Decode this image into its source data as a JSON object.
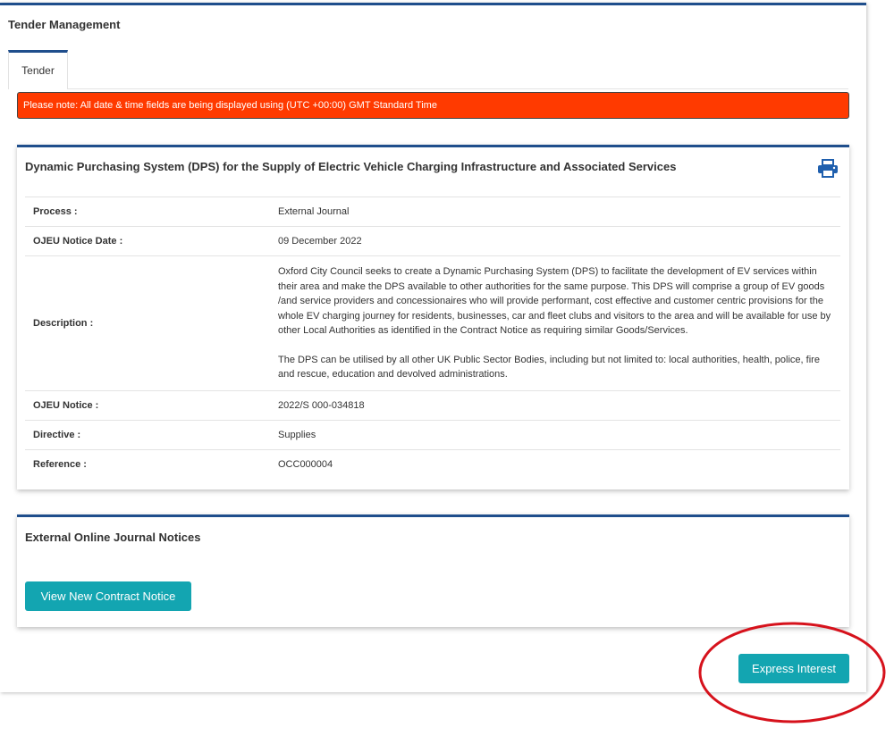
{
  "header": {
    "title": "Tender Management"
  },
  "tabs": [
    {
      "label": "Tender",
      "active": true
    }
  ],
  "notice": {
    "text": "Please note: All date & time fields are being displayed using (UTC +00:00) GMT Standard Time",
    "color": "#ff3a00"
  },
  "tender": {
    "title": "Dynamic Purchasing System (DPS) for the Supply of Electric Vehicle Charging Infrastructure and Associated Services",
    "print_icon": "printer-icon",
    "fields": {
      "process": {
        "label": "Process :",
        "value": "External Journal"
      },
      "ojeu_notice_date": {
        "label": "OJEU Notice Date :",
        "value": "09 December 2022"
      },
      "description": {
        "label": "Description :",
        "paragraphs": [
          "Oxford City Council seeks to create a Dynamic Purchasing System (DPS) to facilitate the development of EV services within their area and make the DPS available to other authorities for the same purpose. This DPS will comprise a group of EV goods /and service providers and concessionaires who will provide performant, cost effective and customer centric provisions for the whole EV charging journey for residents, businesses, car and fleet clubs and visitors to the area and will be available for use by other Local Authorities as identified in the Contract Notice as requiring similar Goods/Services.",
          "The DPS can be utilised by all other UK Public Sector Bodies, including but not limited to: local authorities, health, police, fire and rescue, education and devolved administrations."
        ]
      },
      "ojeu_notice": {
        "label": "OJEU Notice :",
        "value": "2022/S 000-034818"
      },
      "directive": {
        "label": "Directive :",
        "value": "Supplies"
      },
      "reference": {
        "label": "Reference :",
        "value": "OCC000004"
      }
    }
  },
  "journal": {
    "title": "External Online Journal Notices",
    "view_button_label": "View New Contract Notice"
  },
  "actions": {
    "express_interest_label": "Express Interest"
  },
  "colors": {
    "accent_border": "#1f4e8c",
    "button": "#13a5b1",
    "highlight": "#d6121c"
  }
}
